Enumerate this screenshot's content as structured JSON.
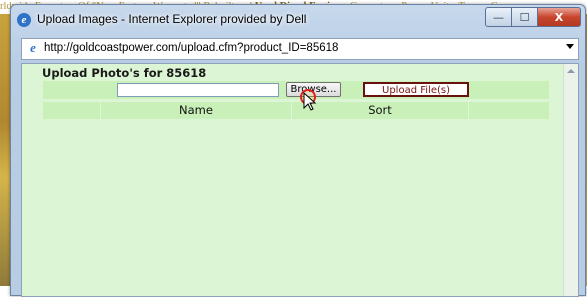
{
  "background_page": {
    "header_text_pre": "rldwide Exporters Of \"New Factory Warranted\" Rebuilt and ",
    "header_text_bold": "Used Diesel Engines",
    "header_text_post": ", Generators, Power Units, Torque Conve"
  },
  "window": {
    "title": "Upload Images - Internet Explorer provided by Dell",
    "minimize_glyph": "—",
    "maximize_glyph": "☐",
    "close_glyph": "X"
  },
  "address_bar": {
    "url": "http://goldcoastpower.com/upload.cfm?product_ID=85618"
  },
  "page": {
    "heading": "Upload Photo's for 85618",
    "file_input_value": "",
    "browse_label": "Browse...",
    "upload_label": "Upload File(s)",
    "table": {
      "columns": [
        "Name",
        "Sort"
      ]
    }
  },
  "colors": {
    "content_bg": "#dcf5d5",
    "row_bg": "#c9f0b8",
    "upload_border": "#6b1010"
  }
}
